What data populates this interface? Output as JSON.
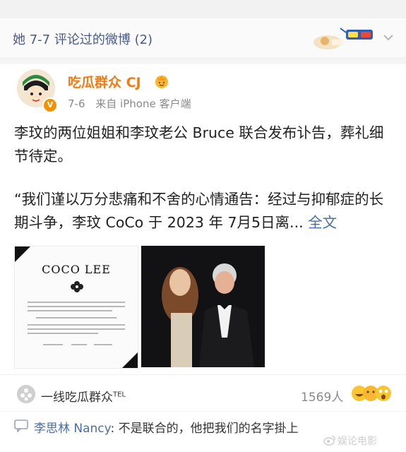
{
  "section": {
    "title": "她 7-7 评论过的微博 (2)"
  },
  "post": {
    "username": "吃瓜群众 CJ",
    "verified_badge": "V",
    "date": "7-6",
    "source": "来自 iPhone 客户端",
    "paragraph1": "李玟的两位姐姐和李玟老公 Bruce 联合发布讣告，葬礼细节待定。",
    "paragraph2": "“我们谨以万分悲痛和不舍的心情通告：经过与抑郁症的长期斗争，李玟 CoCo 于 2023 年 7月5日离...",
    "full_text_link": "全文",
    "notice_image": {
      "title": "COCO LEE"
    }
  },
  "footer": {
    "group_name": "一线吃瓜群众",
    "group_sup": "TEL",
    "likes": "1569人"
  },
  "comment": {
    "author": "李思林 Nancy",
    "text": ": 不是联合的，他把我们的名字掛上"
  },
  "watermark": {
    "brand": "娱论电影"
  },
  "icons": [
    "sticker-icon",
    "chevron-down-icon",
    "verified-icon",
    "emoji-badge-icon",
    "flower-icon",
    "group-icon",
    "reaction-emoji-icon",
    "comment-icon",
    "weibo-logo-icon"
  ],
  "colors": {
    "accent": "#f07c15",
    "link": "#4a6ea8",
    "title": "#4a5c86"
  }
}
